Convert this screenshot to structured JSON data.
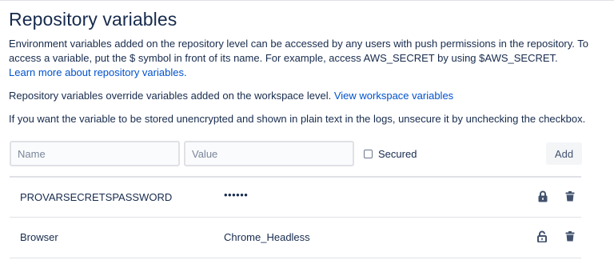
{
  "page": {
    "title": "Repository variables",
    "description_1": "Environment variables added on the repository level can be accessed by any users with push permissions in the repository. To access a variable, put the $ symbol in front of its name. For example, access AWS_SECRET by using $AWS_SECRET.",
    "learn_more_link": "Learn more about repository variables.",
    "description_2": "Repository variables override variables added on the workspace level.",
    "workspace_link": "View workspace variables",
    "description_3": "If you want the variable to be stored unencrypted and shown in plain text in the logs, unsecure it by unchecking the checkbox."
  },
  "form": {
    "name_placeholder": "Name",
    "value_placeholder": "Value",
    "secured_label": "Secured",
    "secured_checked": false,
    "add_label": "Add"
  },
  "variables": [
    {
      "name": "PROVARSECRETSPASSWORD",
      "value": "••••••",
      "secured": true,
      "lock_icon": "lock-closed-icon"
    },
    {
      "name": "Browser",
      "value": "Chrome_Headless",
      "secured": false,
      "lock_icon": "lock-open-icon"
    }
  ],
  "colors": {
    "text": "#172b4d",
    "link": "#0052cc",
    "icon": "#42526e",
    "border": "#dfe1e6"
  }
}
